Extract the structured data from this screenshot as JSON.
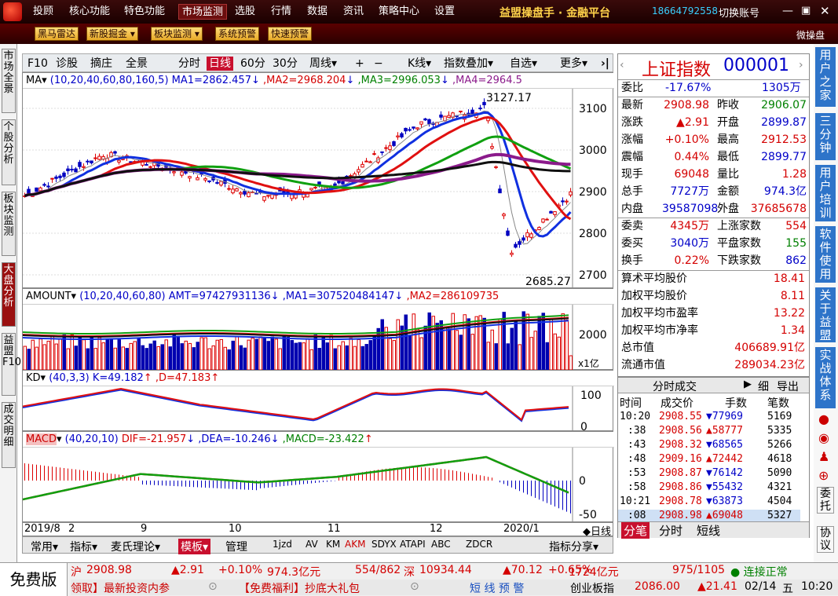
{
  "titlebar": {
    "menu": [
      "投顾",
      "核心功能",
      "特色功能",
      "市场监测",
      "选股",
      "行情",
      "数据",
      "资讯",
      "策略中心",
      "设置"
    ],
    "brand": "益盟操盘手 · 金融平台",
    "phone": "18664792558",
    "switch": "切换账号"
  },
  "toolbar": {
    "buttons": [
      "黑马雷达",
      "新股掘金",
      "板块监测",
      "系统预警",
      "快速预警"
    ],
    "right": "微操盘"
  },
  "leftstrip": {
    "tabs": [
      "市场全景",
      "个股分析",
      "板块监测",
      "大盘分析",
      "益盟F10",
      "成交明细"
    ]
  },
  "chartheader": {
    "items": [
      "F10",
      "诊股",
      "摘庄",
      "全景",
      "分时",
      "日线",
      "60分",
      "30分",
      "周线",
      "K线",
      "指数叠加",
      "自选",
      "更多"
    ],
    "plus": "+",
    "minus": "−"
  },
  "ma": {
    "label": "MA",
    "params": "(10,20,40,60,80,160,5)",
    "ma1": "MA1=2862.457",
    "ma2": ",MA2=2968.204",
    "ma3": ",MA3=2996.053",
    "ma4": ",MA4=2964.5",
    "hi": "3127.17",
    "lo": "2685.27",
    "y": [
      "3100",
      "3000",
      "2900",
      "2800",
      "2700"
    ]
  },
  "amount": {
    "label": "AMOUNT",
    "params": "(10,20,40,60,80)",
    "amt": "AMT=97427931136",
    "ma1": ",MA1=307520484147",
    "ma2": ",MA2=286109735",
    "y": "2000",
    "unit": "x1亿"
  },
  "kd": {
    "label": "KD",
    "params": "(40,3,3)",
    "k": "K=49.182",
    "d": ",D=47.183",
    "y": [
      "100",
      "0"
    ]
  },
  "macd": {
    "label": "MACD",
    "params": "(40,20,10)",
    "dif": "DIF=-21.957",
    "dea": ",DEA=-10.246",
    "macd": ",MACD=-23.422",
    "y": [
      "0",
      "-50"
    ]
  },
  "xaxis": {
    "labels": [
      "2019/8",
      "9",
      "10",
      "11",
      "12",
      "2020/1",
      "2"
    ],
    "right": "◆日线"
  },
  "bottomtabs": {
    "items": [
      "常用",
      "指标",
      "麦氏理论",
      "模板",
      "管理",
      "1jzd",
      "AV",
      "KM",
      "AKM",
      "SDYX",
      "ATAPI",
      "ABC",
      "ZDCR",
      "指标分享"
    ]
  },
  "info": {
    "name": "上证指数",
    "code": "000001",
    "weibi": [
      "委比",
      "-17.67%",
      "1305万"
    ],
    "rows": [
      [
        "最新",
        "2908.98",
        "昨收",
        "2906.07"
      ],
      [
        "涨跌",
        "▲2.91",
        "开盘",
        "2899.87"
      ],
      [
        "涨幅",
        "+0.10%",
        "最高",
        "2912.53"
      ],
      [
        "震幅",
        "0.44%",
        "最低",
        "2899.77"
      ],
      [
        "现手",
        "69048",
        "量比",
        "1.28"
      ],
      [
        "总手",
        "7727万",
        "金额",
        "974.3亿"
      ],
      [
        "内盘",
        "39587098",
        "外盘",
        "37685678"
      ]
    ],
    "rows2": [
      [
        "委卖",
        "4345万",
        "上涨家数",
        "554"
      ],
      [
        "委买",
        "3040万",
        "平盘家数",
        "155"
      ],
      [
        "换手",
        "0.22%",
        "下跌家数",
        "862"
      ]
    ],
    "stats": [
      [
        "算术平均股价",
        "18.41"
      ],
      [
        "加权平均股价",
        "8.11"
      ],
      [
        "加权平均市盈率",
        "13.22"
      ],
      [
        "加权平均市净率",
        "1.34"
      ],
      [
        "总市值",
        "406689.91亿"
      ],
      [
        "流通市值",
        "289034.23亿"
      ]
    ]
  },
  "ticks": {
    "title": "分时成交",
    "tabs": [
      "细",
      "导出"
    ],
    "cols": [
      "时间",
      "成交价",
      "手数",
      "笔数"
    ],
    "rows": [
      [
        "10:20",
        "2908.55",
        "▼77969",
        "5169"
      ],
      [
        ":38",
        "2908.56",
        "▲58777",
        "5335"
      ],
      [
        ":43",
        "2908.32",
        "▼68565",
        "5266"
      ],
      [
        ":48",
        "2909.16",
        "▲72442",
        "4618"
      ],
      [
        ":53",
        "2908.87",
        "▼76142",
        "5090"
      ],
      [
        ":58",
        "2908.86",
        "▼55432",
        "4321"
      ],
      [
        "10:21",
        "2908.78",
        "▼63873",
        "4504"
      ],
      [
        ":08",
        "2908.98",
        "▲69048",
        "5327"
      ]
    ],
    "bottom": [
      "分笔",
      "分时",
      "短线"
    ]
  },
  "rightstrip": {
    "tabs": [
      "用户之家",
      "三分钟",
      "用户培训",
      "软件使用",
      "关于益盟",
      "实战体系"
    ],
    "extra": [
      "委托",
      "协议"
    ]
  },
  "status": {
    "free": "免费版",
    "sh": [
      "沪",
      "2908.98",
      "▲2.91",
      "+0.10%",
      "974.3亿元",
      "554/862"
    ],
    "sz": [
      "深",
      "10934.44",
      "▲70.12",
      "+0.65%",
      "1724亿元",
      "975/1105"
    ],
    "conn": "连接正常",
    "news": [
      "领取】最新投资内参",
      "【免费福利】抄底大礼包",
      "短 线 预 警"
    ],
    "cyb": [
      "创业板指",
      "2086.00",
      "▲21.41"
    ],
    "date": "02/14",
    "wd": "五",
    "time": "10:20"
  }
}
